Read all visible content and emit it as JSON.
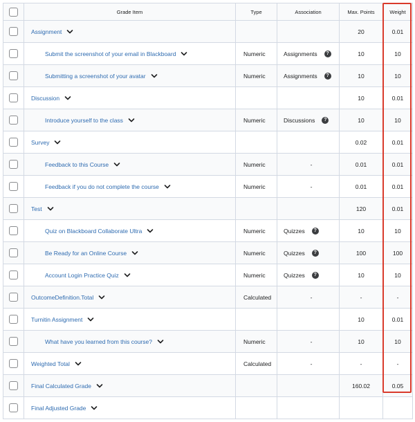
{
  "columns": {
    "select_all": "",
    "grade_item": "Grade Item",
    "type": "Type",
    "association": "Association",
    "max_points": "Max. Points",
    "weight": "Weight"
  },
  "rows": [
    {
      "name": "Assignment",
      "level": 0,
      "type": "",
      "association": "",
      "has_help": false,
      "max_points": "20",
      "weight": "0.01"
    },
    {
      "name": "Submit the screenshot of your email in Blackboard",
      "level": 1,
      "type": "Numeric",
      "association": "Assignments",
      "has_help": true,
      "max_points": "10",
      "weight": "10"
    },
    {
      "name": "Submitting a screenshot of your avatar",
      "level": 1,
      "type": "Numeric",
      "association": "Assignments",
      "has_help": true,
      "max_points": "10",
      "weight": "10"
    },
    {
      "name": "Discussion",
      "level": 0,
      "type": "",
      "association": "",
      "has_help": false,
      "max_points": "10",
      "weight": "0.01"
    },
    {
      "name": "Introduce yourself to the class",
      "level": 1,
      "type": "Numeric",
      "association": "Discussions",
      "has_help": true,
      "max_points": "10",
      "weight": "10"
    },
    {
      "name": "Survey",
      "level": 0,
      "type": "",
      "association": "",
      "has_help": false,
      "max_points": "0.02",
      "weight": "0.01"
    },
    {
      "name": "Feedback to this Course",
      "level": 1,
      "type": "Numeric",
      "association": "-",
      "has_help": false,
      "max_points": "0.01",
      "weight": "0.01"
    },
    {
      "name": "Feedback if you do not complete the course",
      "level": 1,
      "type": "Numeric",
      "association": "-",
      "has_help": false,
      "max_points": "0.01",
      "weight": "0.01"
    },
    {
      "name": "Test",
      "level": 0,
      "type": "",
      "association": "",
      "has_help": false,
      "max_points": "120",
      "weight": "0.01"
    },
    {
      "name": "Quiz on Blackboard Collaborate Ultra",
      "level": 1,
      "type": "Numeric",
      "association": "Quizzes",
      "has_help": true,
      "max_points": "10",
      "weight": "10"
    },
    {
      "name": "Be Ready for an Online Course",
      "level": 1,
      "type": "Numeric",
      "association": "Quizzes",
      "has_help": true,
      "max_points": "100",
      "weight": "100"
    },
    {
      "name": "Account Login Practice Quiz",
      "level": 1,
      "type": "Numeric",
      "association": "Quizzes",
      "has_help": true,
      "max_points": "10",
      "weight": "10"
    },
    {
      "name": "OutcomeDefinition.Total",
      "level": 0,
      "type": "Calculated",
      "association": "-",
      "has_help": false,
      "max_points": "-",
      "weight": "-"
    },
    {
      "name": "Turnitin Assignment",
      "level": 0,
      "type": "",
      "association": "",
      "has_help": false,
      "max_points": "10",
      "weight": "0.01"
    },
    {
      "name": "What have you learned from this course?",
      "level": 1,
      "type": "Numeric",
      "association": "-",
      "has_help": false,
      "max_points": "10",
      "weight": "10"
    },
    {
      "name": "Weighted Total",
      "level": 0,
      "type": "Calculated",
      "association": "-",
      "has_help": false,
      "max_points": "-",
      "weight": "-"
    },
    {
      "name": "Final Calculated Grade",
      "level": 0,
      "type": "",
      "association": "",
      "has_help": false,
      "max_points": "160.02",
      "weight": "0.05"
    },
    {
      "name": "Final Adjusted Grade",
      "level": 0,
      "type": "",
      "association": "",
      "has_help": false,
      "max_points": "",
      "weight": ""
    }
  ],
  "icons": {
    "row_menu": "chevron-down-icon",
    "association_help": "help-circle-icon"
  },
  "help_glyph": "?",
  "colors": {
    "link": "#2e6bb0",
    "highlight_border": "#d93a2b",
    "grid_border": "#d3d9e3",
    "alt_row_bg": "#f9fafb"
  }
}
